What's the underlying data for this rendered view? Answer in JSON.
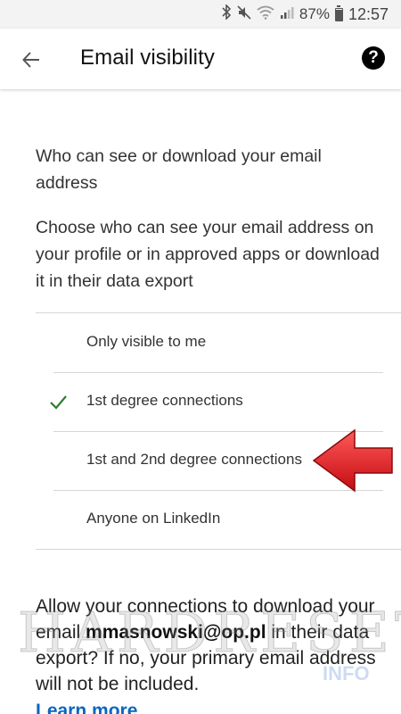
{
  "status_bar": {
    "battery_percent": "87%",
    "battery_level": 0.87,
    "time": "12:57",
    "icons": [
      "bluetooth-icon",
      "mute-icon",
      "wifi-icon",
      "signal-icon",
      "battery-icon"
    ]
  },
  "app_bar": {
    "title": "Email visibility",
    "back_icon": "arrow-left-icon",
    "help_icon": "help-icon",
    "help_glyph": "?"
  },
  "content": {
    "heading": "Who can see or download your email address",
    "description": "Choose who can see your email address on your profile or in approved apps or download it in their data export",
    "options": [
      {
        "label": "Only visible to me",
        "selected": false
      },
      {
        "label": "1st degree connections",
        "selected": true
      },
      {
        "label": "1st and 2nd degree connections",
        "selected": false
      },
      {
        "label": "Anyone on LinkedIn",
        "selected": false
      }
    ],
    "allow_text_prefix": "Allow your connections to download your email ",
    "email": "mmasnowski@op.pl",
    "allow_text_suffix": " in their data export? If no, your primary email address will not be included.",
    "learn_more": "Learn more"
  },
  "watermark": {
    "text": "HARDRESET",
    "sub": "INFO"
  },
  "colors": {
    "accent_link": "#0a66c2",
    "check_green": "#2e7d32",
    "arrow_red": "#e0141b"
  }
}
